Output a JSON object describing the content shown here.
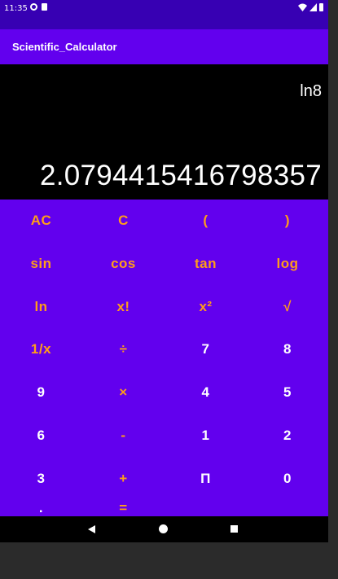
{
  "status": {
    "time": "11:35"
  },
  "appbar": {
    "title": "Scientific_Calculator"
  },
  "display": {
    "expression": "ln8",
    "result": "2.0794415416798357"
  },
  "keys": [
    {
      "label": "AC",
      "type": "op",
      "name": "all-clear-button"
    },
    {
      "label": "C",
      "type": "op",
      "name": "clear-button"
    },
    {
      "label": "(",
      "type": "op",
      "name": "open-paren-button"
    },
    {
      "label": ")",
      "type": "op",
      "name": "close-paren-button"
    },
    {
      "label": "sin",
      "type": "op",
      "name": "sin-button"
    },
    {
      "label": "cos",
      "type": "op",
      "name": "cos-button"
    },
    {
      "label": "tan",
      "type": "op",
      "name": "tan-button"
    },
    {
      "label": "log",
      "type": "op",
      "name": "log-button"
    },
    {
      "label": "ln",
      "type": "op",
      "name": "ln-button"
    },
    {
      "label": "x!",
      "type": "op",
      "name": "factorial-button"
    },
    {
      "label": "x²",
      "type": "op",
      "name": "square-button"
    },
    {
      "label": "√",
      "type": "op",
      "name": "sqrt-button"
    },
    {
      "label": "1/x",
      "type": "op",
      "name": "reciprocal-button"
    },
    {
      "label": "÷",
      "type": "op",
      "name": "divide-button"
    },
    {
      "label": "7",
      "type": "num",
      "name": "digit-7-button"
    },
    {
      "label": "8",
      "type": "num",
      "name": "digit-8-button"
    },
    {
      "label": "9",
      "type": "num",
      "name": "digit-9-button"
    },
    {
      "label": "×",
      "type": "op",
      "name": "multiply-button"
    },
    {
      "label": "4",
      "type": "num",
      "name": "digit-4-button"
    },
    {
      "label": "5",
      "type": "num",
      "name": "digit-5-button"
    },
    {
      "label": "6",
      "type": "num",
      "name": "digit-6-button"
    },
    {
      "label": "-",
      "type": "op",
      "name": "subtract-button"
    },
    {
      "label": "1",
      "type": "num",
      "name": "digit-1-button"
    },
    {
      "label": "2",
      "type": "num",
      "name": "digit-2-button"
    },
    {
      "label": "3",
      "type": "num",
      "name": "digit-3-button"
    },
    {
      "label": "+",
      "type": "op",
      "name": "add-button"
    },
    {
      "label": "Π",
      "type": "num",
      "name": "pi-button"
    },
    {
      "label": "0",
      "type": "num",
      "name": "digit-0-button"
    },
    {
      "label": ".",
      "type": "num",
      "name": "decimal-button"
    },
    {
      "label": "=",
      "type": "op",
      "name": "equals-button"
    }
  ],
  "colors": {
    "primary": "#6200ee",
    "primary_dark": "#3700b3",
    "operator_text": "#ff9d1a",
    "number_text": "#ffffff"
  },
  "icons": {
    "nav_back": "back-triangle-icon",
    "nav_home": "home-circle-icon",
    "nav_recent": "recents-square-icon"
  }
}
